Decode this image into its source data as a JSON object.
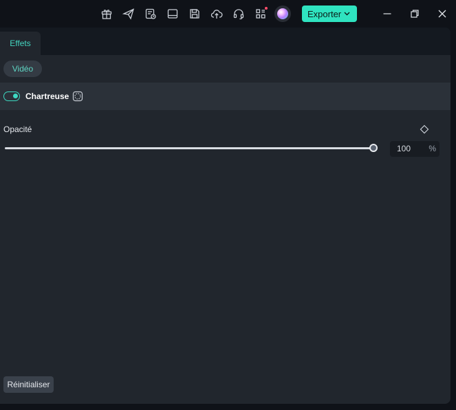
{
  "titlebar": {
    "icons": [
      "gift-icon",
      "send-icon",
      "task-list-icon",
      "layout-icon",
      "save-icon",
      "cloud-upload-icon",
      "headset-icon",
      "apps-grid-icon"
    ],
    "export_label": "Exporter"
  },
  "tabs": [
    {
      "label": "Effets",
      "active": true
    }
  ],
  "category_pill": "Vidéo",
  "effect": {
    "name": "Chartreuse",
    "enabled": true
  },
  "opacity": {
    "label": "Opacité",
    "value": "100",
    "unit": "%",
    "fraction": 1.0
  },
  "reset_label": "Réinitialiser",
  "colors": {
    "accent": "#2fe3c0",
    "panel": "#21262d",
    "background": "#0f1218"
  }
}
